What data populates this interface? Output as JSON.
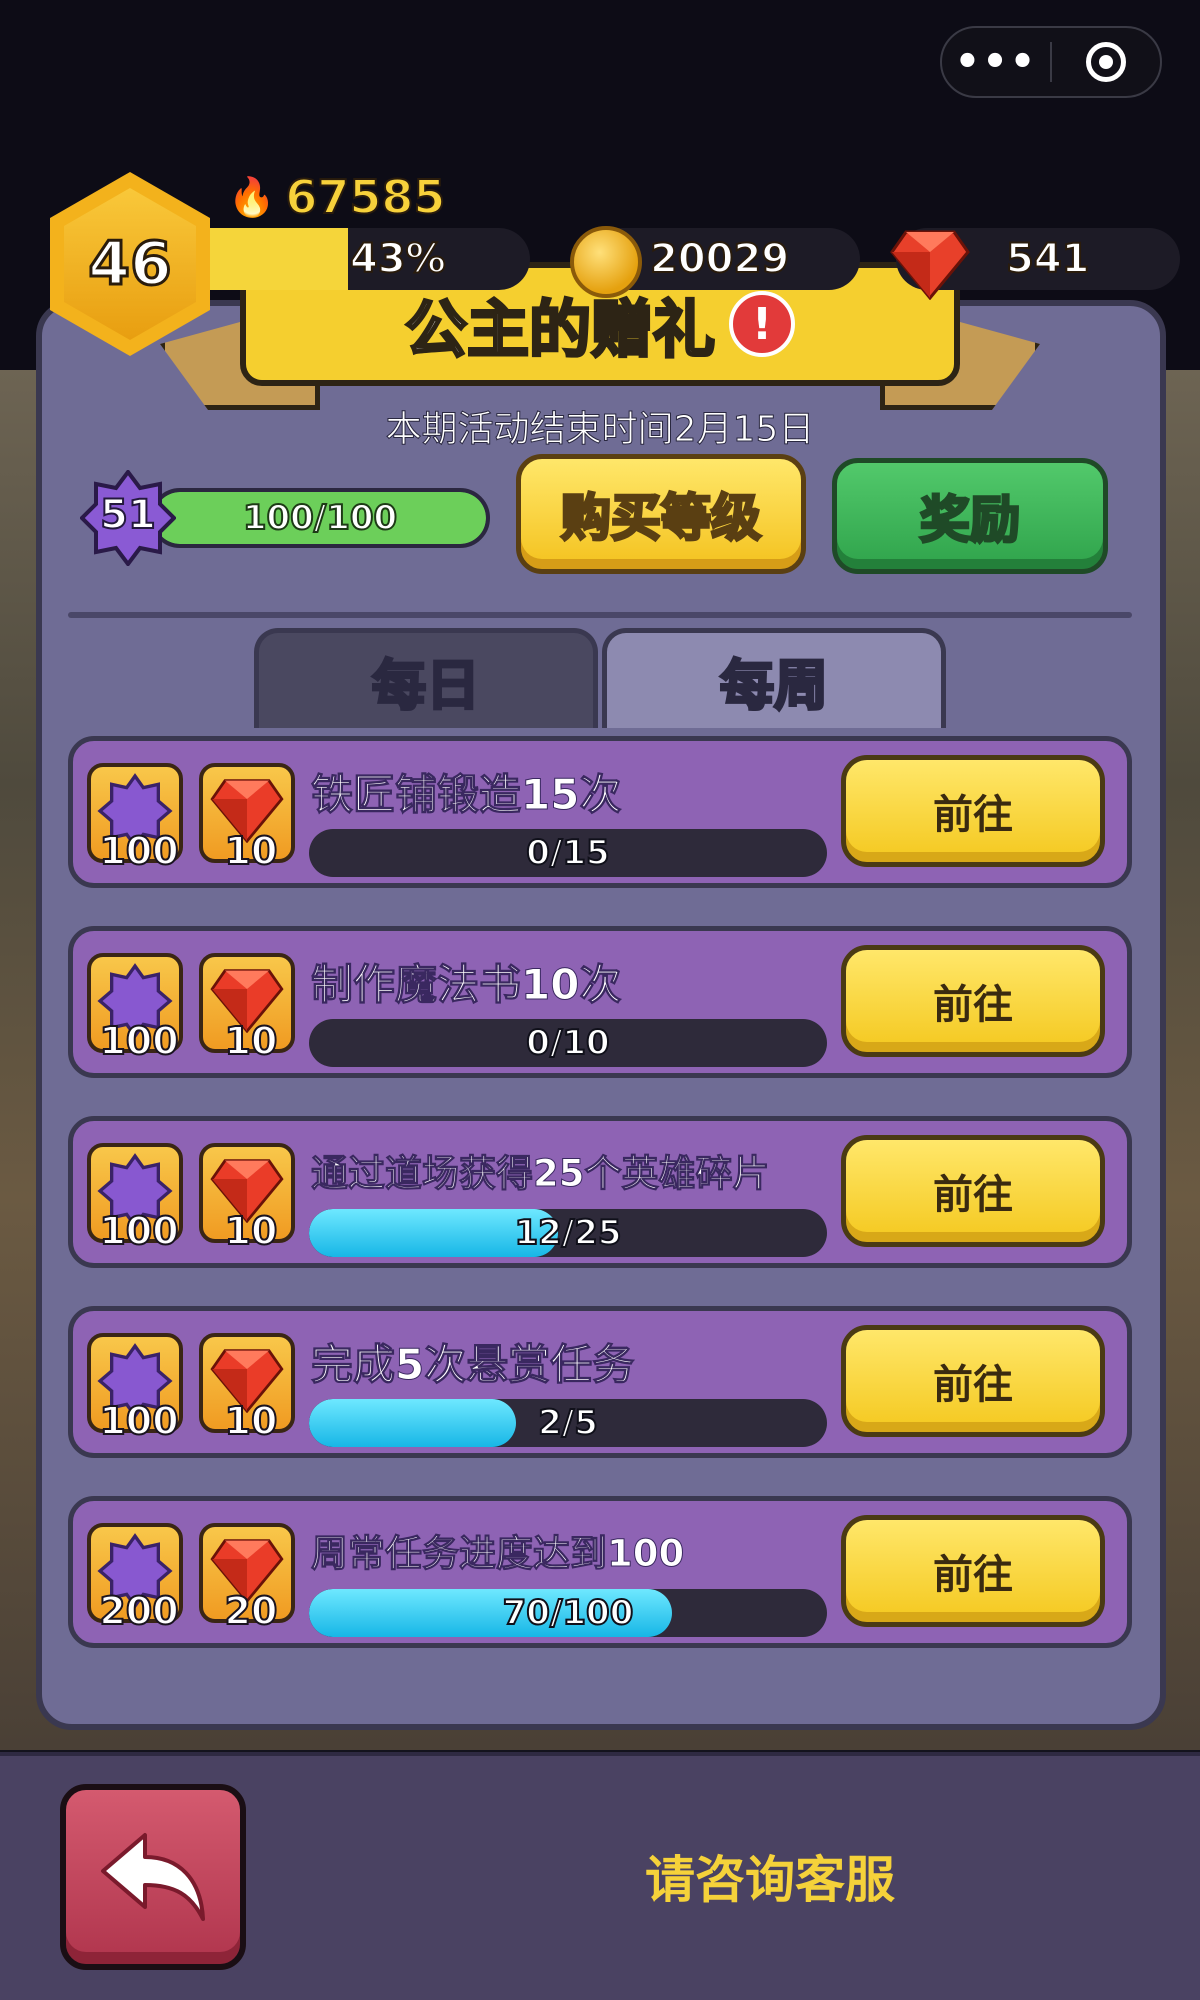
{
  "top_capsule": {
    "more_icon": "more-dots-icon",
    "close_icon": "target-circle-icon"
  },
  "hud": {
    "level": "46",
    "power": "67585",
    "xp_percent_label": "43%",
    "xp_progress": 0.43,
    "gold": "20029",
    "gems": "541"
  },
  "event": {
    "title": "公主的赠礼",
    "alert": "!",
    "end_time": "本期活动结束时间2月15日"
  },
  "pass": {
    "level": "51",
    "progress_label": "100/100",
    "progress": 1.0,
    "buy_level_label": "购买等级",
    "reward_label": "奖励"
  },
  "tabs": [
    {
      "label": "每日",
      "active": false
    },
    {
      "label": "每周",
      "active": true
    }
  ],
  "tasks": [
    {
      "title": "铁匠铺锻造15次",
      "star_reward": "100",
      "gem_reward": "10",
      "progress_label": "0/15",
      "progress": 0.0,
      "button": "前往"
    },
    {
      "title": "制作魔法书10次",
      "star_reward": "100",
      "gem_reward": "10",
      "progress_label": "0/10",
      "progress": 0.0,
      "button": "前往"
    },
    {
      "title": "通过道场获得25个英雄碎片",
      "star_reward": "100",
      "gem_reward": "10",
      "progress_label": "12/25",
      "progress": 0.48,
      "button": "前往"
    },
    {
      "title": "完成5次悬赏任务",
      "star_reward": "100",
      "gem_reward": "10",
      "progress_label": "2/5",
      "progress": 0.4,
      "button": "前往"
    },
    {
      "title": "周常任务进度达到100",
      "star_reward": "200",
      "gem_reward": "20",
      "progress_label": "70/100",
      "progress": 0.7,
      "button": "前往"
    }
  ],
  "footer": {
    "contact_label": "请咨询客服",
    "back_icon": "back-arrow-icon"
  },
  "colors": {
    "task_bg": "#8e63b4",
    "button_yellow": "#f4c81e",
    "progress_cyan": "#17b6e6",
    "panel": "#6f6c95"
  }
}
